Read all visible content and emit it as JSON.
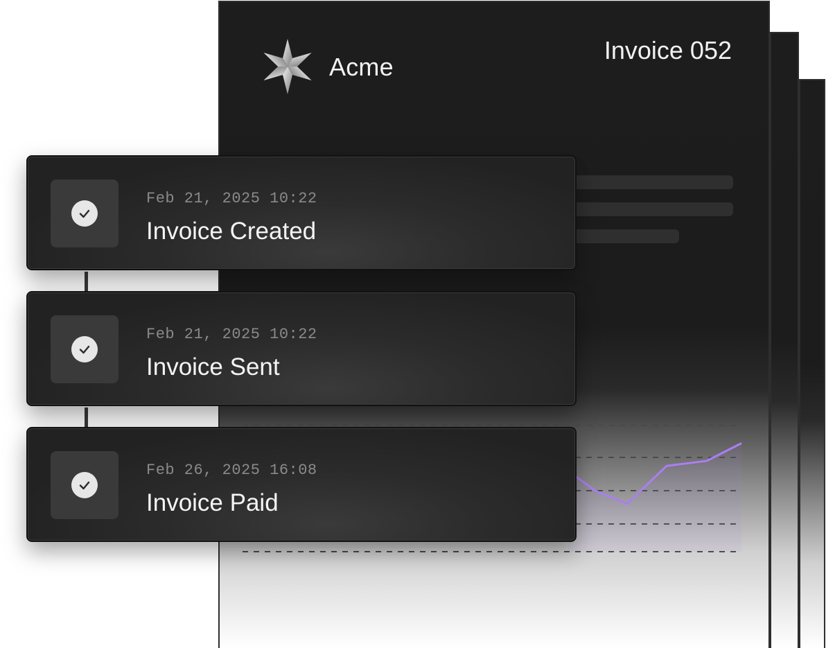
{
  "document": {
    "brand_name": "Acme",
    "title": "Invoice 052",
    "logo_icon": "star-logo-icon"
  },
  "chart_data": {
    "type": "line",
    "x": [
      0,
      1,
      2,
      3,
      4,
      5
    ],
    "values": [
      3.2,
      2.4,
      1.9,
      3.4,
      3.6,
      4.3
    ],
    "color": "#a97ff0",
    "grid": true
  },
  "timeline": {
    "events": [
      {
        "timestamp": "Feb 21, 2025 10:22",
        "label": "Invoice Created",
        "icon": "check-circle-icon"
      },
      {
        "timestamp": "Feb 21, 2025 10:22",
        "label": "Invoice Sent",
        "icon": "check-circle-icon"
      },
      {
        "timestamp": "Feb 26, 2025 16:08",
        "label": "Invoice Paid",
        "icon": "check-circle-icon"
      }
    ]
  },
  "colors": {
    "accent": "#a97ff0",
    "card_bg": "#2b2b2b",
    "doc_bg": "#1d1d1d"
  }
}
